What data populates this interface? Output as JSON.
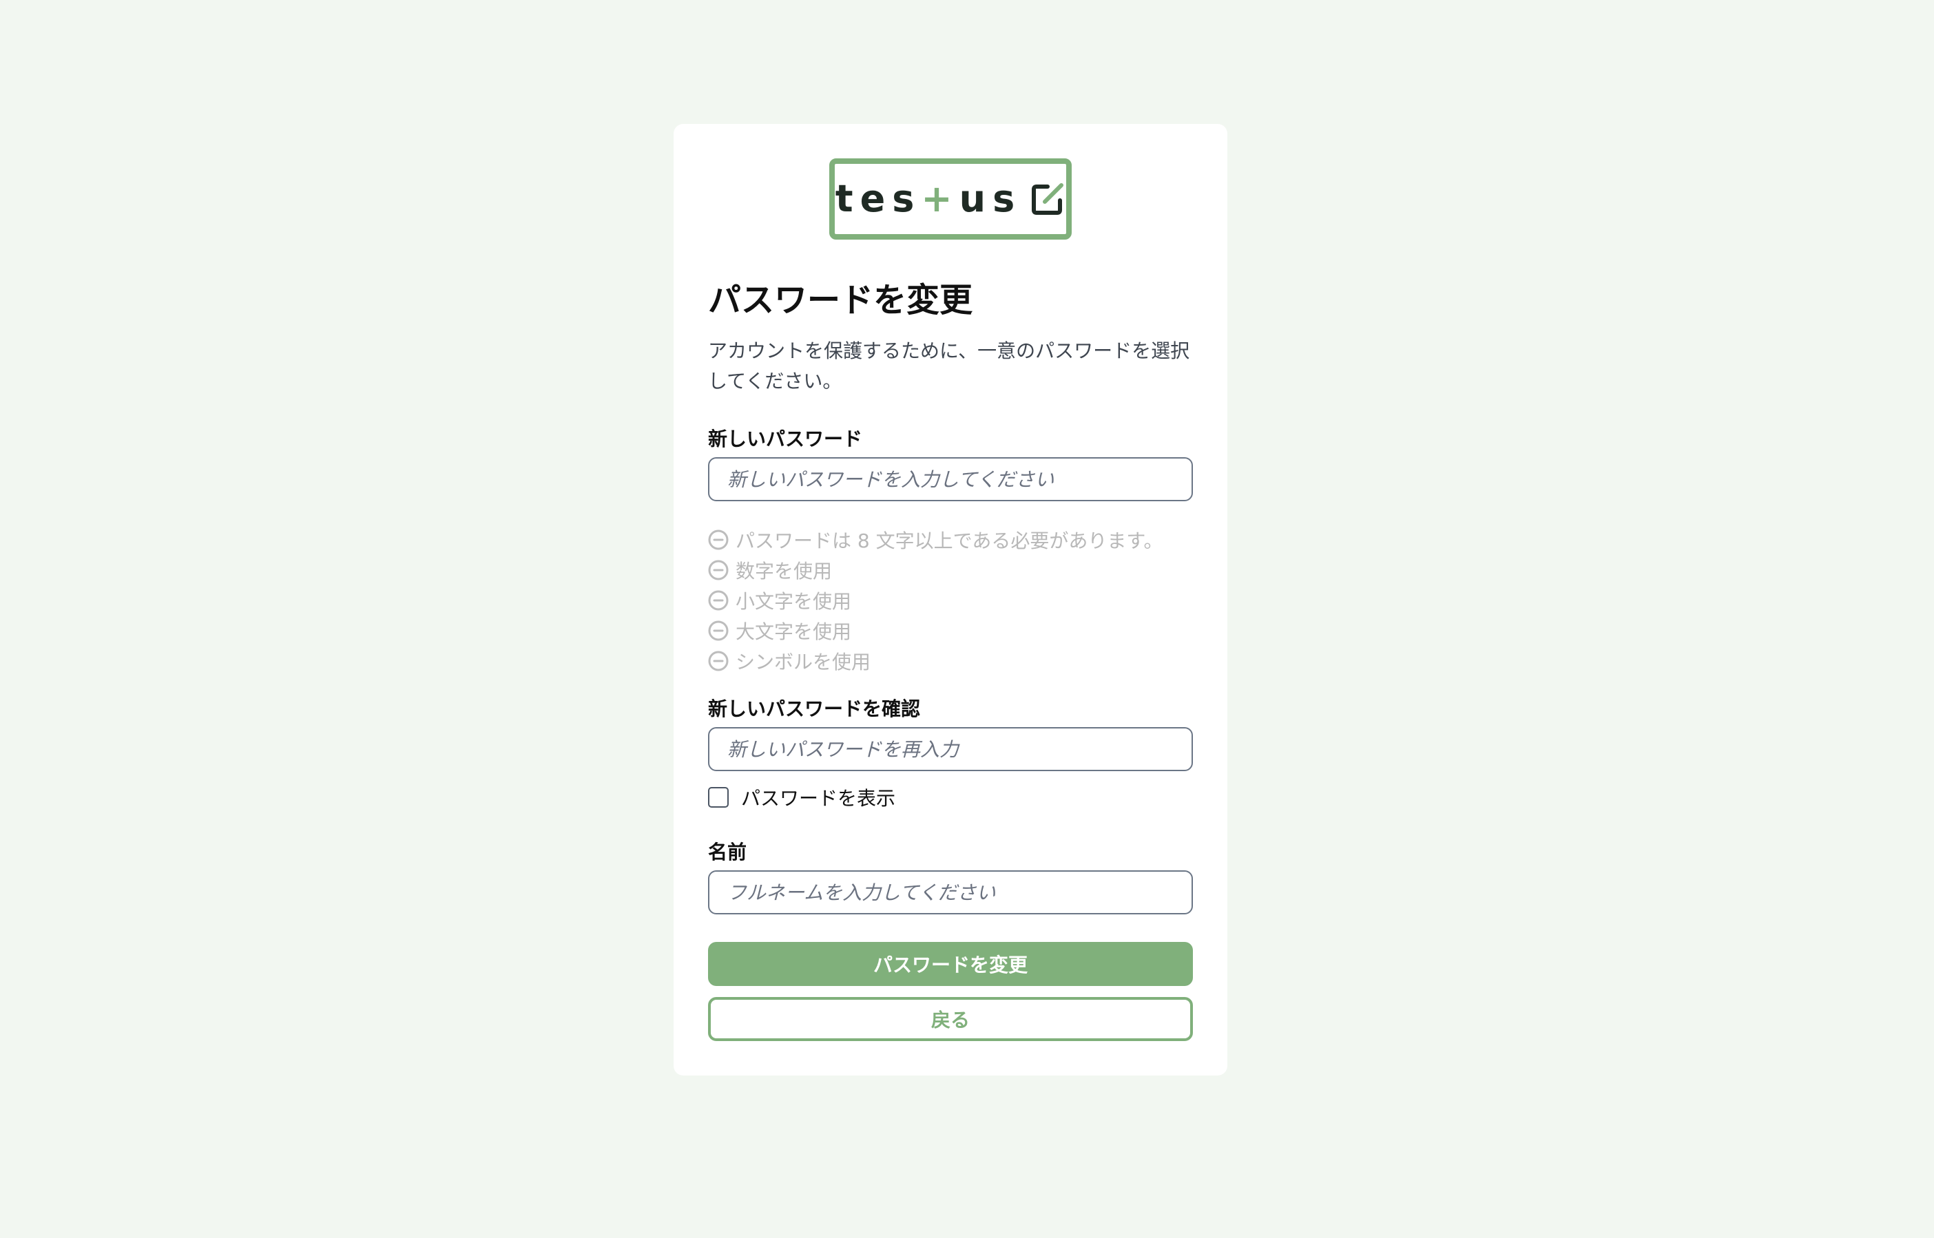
{
  "brand": {
    "logo_pre": "tes",
    "logo_plus": "+",
    "logo_post": "us",
    "accent_color": "#80b07b"
  },
  "page": {
    "title": "パスワードを変更",
    "subtitle": "アカウントを保護するために、一意のパスワードを選択してください。"
  },
  "new_password": {
    "label": "新しいパスワード",
    "placeholder": "新しいパスワードを入力してください",
    "value": ""
  },
  "rules": [
    {
      "text": "パスワードは 8 文字以上である必要があります。",
      "icon": "minus-circle-icon"
    },
    {
      "text": "数字を使用",
      "icon": "minus-circle-icon"
    },
    {
      "text": "小文字を使用",
      "icon": "minus-circle-icon"
    },
    {
      "text": "大文字を使用",
      "icon": "minus-circle-icon"
    },
    {
      "text": "シンボルを使用",
      "icon": "minus-circle-icon"
    }
  ],
  "confirm_password": {
    "label": "新しいパスワードを確認",
    "placeholder": "新しいパスワードを再入力",
    "value": ""
  },
  "show_password": {
    "label": "パスワードを表示",
    "checked": false
  },
  "name": {
    "label": "名前",
    "placeholder": "フルネームを入力してください",
    "value": ""
  },
  "actions": {
    "submit_label": "パスワードを変更",
    "back_label": "戻る"
  }
}
